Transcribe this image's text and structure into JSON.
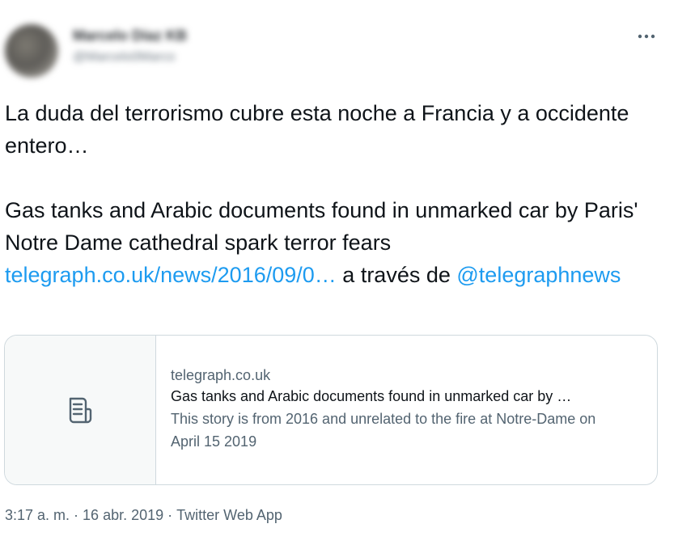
{
  "author": {
    "name": "Marcelo Díaz KB",
    "handle": "@Marcelo0Marco"
  },
  "tweet": {
    "line1": "La duda del terrorismo cubre esta noche a Francia y a occidente entero…",
    "line2": "Gas tanks and Arabic documents found in unmarked car by Paris' Notre Dame cathedral spark terror fears",
    "link_text": "telegraph.co.uk/news/2016/09/0…",
    "via_text": "a través de",
    "mention": "@telegraphnews"
  },
  "card": {
    "icon": "document-icon",
    "domain": "telegraph.co.uk",
    "title": "Gas tanks and Arabic documents found in unmarked car by …",
    "description": "This story is from 2016 and unrelated to the fire at Notre-Dame on April 15 2019"
  },
  "meta": {
    "time": "3:17 a. m.",
    "separator": "·",
    "date": "16 abr. 2019",
    "source": "Twitter Web App"
  },
  "icons": {
    "more": "more-horizontal-icon"
  },
  "colors": {
    "link": "#1d9bf0",
    "text": "#0f1419",
    "muted": "#536471",
    "border": "#cfd9de"
  }
}
